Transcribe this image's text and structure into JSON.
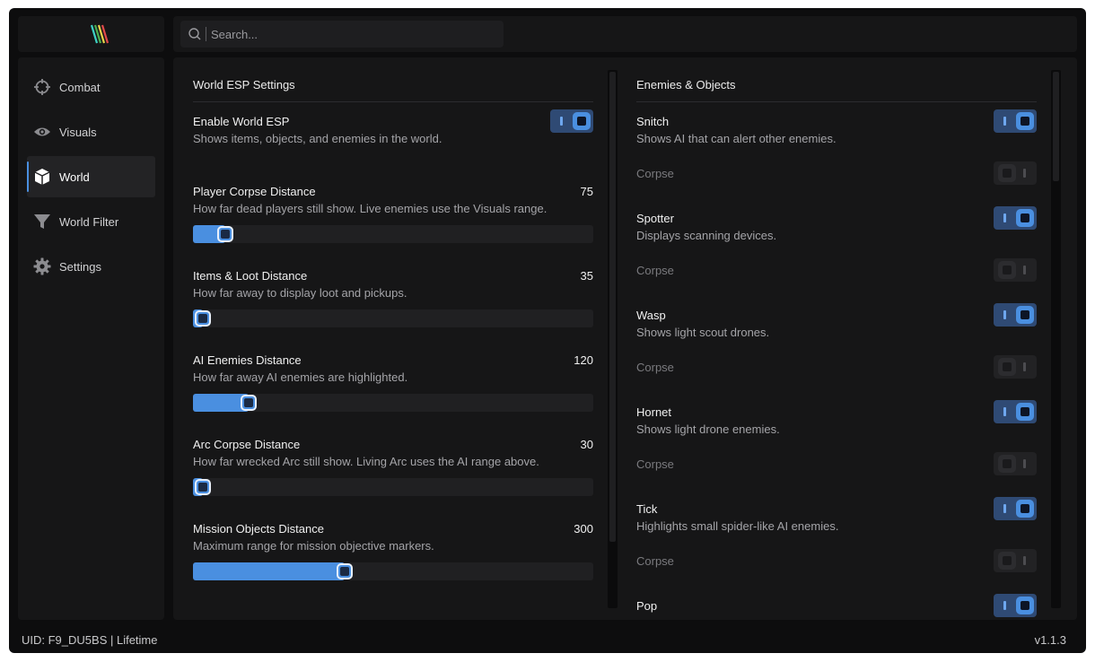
{
  "search": {
    "placeholder": "Search..."
  },
  "sidebar": {
    "items": [
      {
        "label": "Combat",
        "icon": "crosshair-icon"
      },
      {
        "label": "Visuals",
        "icon": "eye-icon"
      },
      {
        "label": "World",
        "icon": "cube-icon",
        "active": true
      },
      {
        "label": "World Filter",
        "icon": "filter-icon"
      },
      {
        "label": "Settings",
        "icon": "gear-icon"
      }
    ]
  },
  "world_esp": {
    "title": "World ESP Settings",
    "enable": {
      "label": "Enable World ESP",
      "desc": "Shows items, objects, and enemies in the world.",
      "on": true
    },
    "sliders": [
      {
        "label": "Player Corpse Distance",
        "desc": "How far dead players still show. Live enemies use the Visuals range.",
        "value": "75",
        "fill": 0.08
      },
      {
        "label": "Items & Loot Distance",
        "desc": "How far away to display loot and pickups.",
        "value": "35",
        "fill": 0.025
      },
      {
        "label": "AI Enemies Distance",
        "desc": "How far away AI enemies are highlighted.",
        "value": "120",
        "fill": 0.14
      },
      {
        "label": "Arc Corpse Distance",
        "desc": "How far wrecked Arc still show. Living Arc uses the AI range above.",
        "value": "30",
        "fill": 0.02
      },
      {
        "label": "Mission Objects Distance",
        "desc": "Maximum range for mission objective markers.",
        "value": "300",
        "fill": 0.38
      }
    ]
  },
  "enemies": {
    "title": "Enemies & Objects",
    "corpse_label": "Corpse",
    "items": [
      {
        "label": "Snitch",
        "desc": "Shows AI that can alert other enemies.",
        "on": true,
        "corpse_on": false
      },
      {
        "label": "Spotter",
        "desc": "Displays scanning devices.",
        "on": true,
        "corpse_on": false
      },
      {
        "label": "Wasp",
        "desc": "Shows light scout drones.",
        "on": true,
        "corpse_on": false
      },
      {
        "label": "Hornet",
        "desc": "Shows light drone enemies.",
        "on": true,
        "corpse_on": false
      },
      {
        "label": "Tick",
        "desc": "Highlights small spider-like AI enemies.",
        "on": true,
        "corpse_on": false
      },
      {
        "label": "Pop",
        "desc": "",
        "on": true,
        "corpse_on": false
      }
    ]
  },
  "footer": {
    "uid": "UID: F9_DU5BS | Lifetime",
    "version": "v1.1.3"
  },
  "colors": {
    "accent": "#4a8fe0",
    "panel": "#161617",
    "background": "#0d0d0e"
  }
}
